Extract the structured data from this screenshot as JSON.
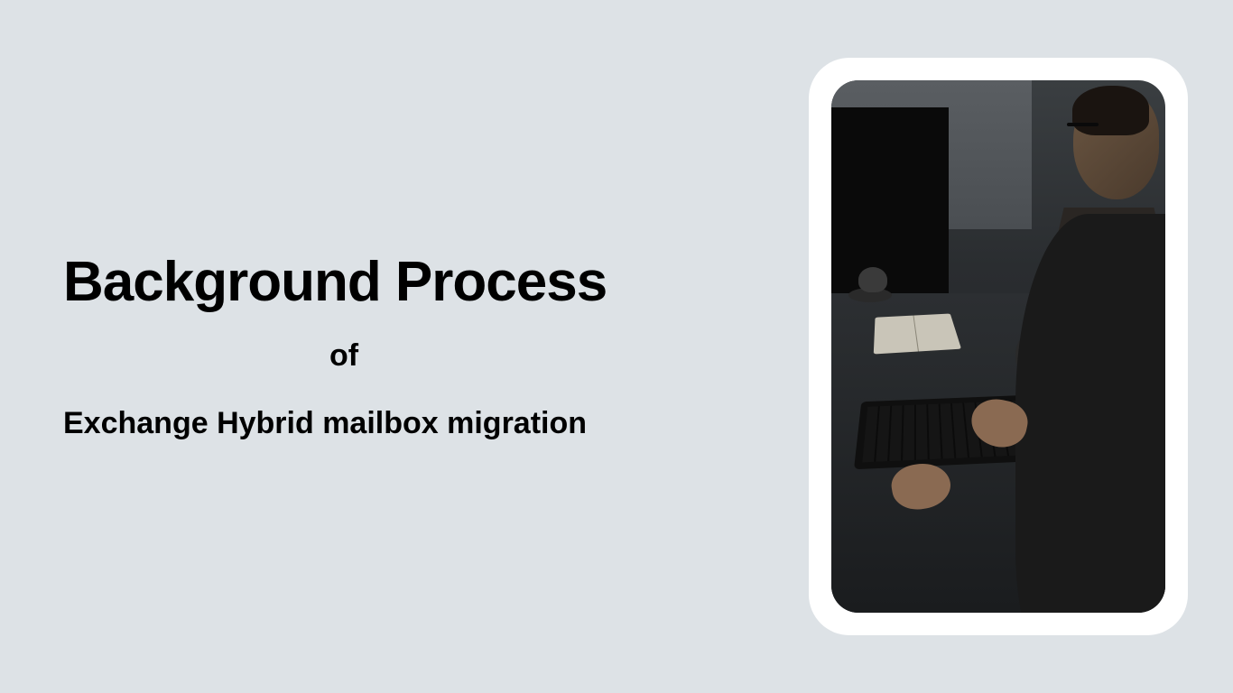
{
  "heading": {
    "main": "Background Process",
    "connector": "of",
    "subject": "Exchange Hybrid mailbox migration"
  },
  "image": {
    "alt": "Person typing on keyboard at desk with monitor, notebook and coffee cup"
  }
}
